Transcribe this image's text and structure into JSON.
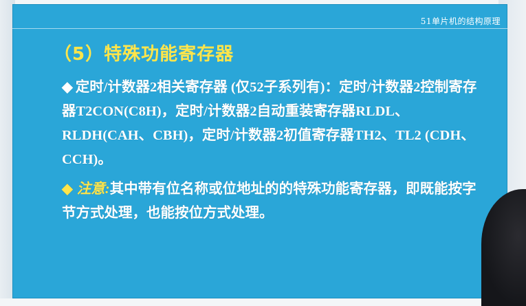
{
  "slide": {
    "course_title": "51单片机的结构原理",
    "section_title": "（5）特殊功能寄存器",
    "paragraph1": {
      "bullet": "◆",
      "text": "定时/计数器2相关寄存器 (仅52子系列有)：定时/计数器2控制寄存器T2CON(C8H)，定时/计数器2自动重装寄存器RLDL、RLDH(CAH、CBH)，定时/计数器2初值寄存器TH2、TL2 (CDH、CCH)。"
    },
    "paragraph2": {
      "bullet": "◆",
      "label": "注意:",
      "text": "其中带有位名称或位地址的的特殊功能寄存器，即既能按字节方式处理，也能按位方式处理。"
    }
  },
  "colors": {
    "slide_background": "#2aa6d8",
    "title_yellow": "#ffe54a",
    "body_text": "#ffffff"
  }
}
